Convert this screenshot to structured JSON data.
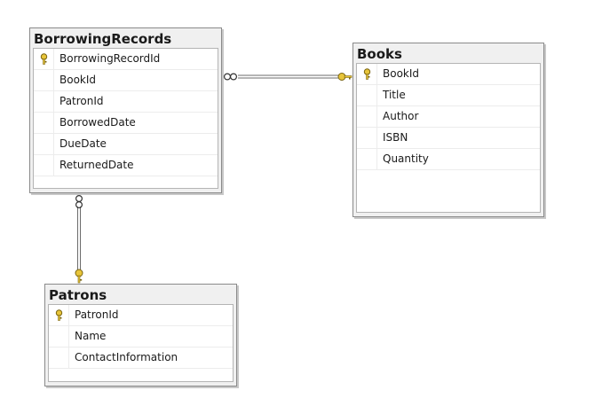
{
  "tables": {
    "borrowing": {
      "title": "BorrowingRecords",
      "columns": [
        {
          "name": "BorrowingRecordId",
          "pk": true
        },
        {
          "name": "BookId",
          "pk": false
        },
        {
          "name": "PatronId",
          "pk": false
        },
        {
          "name": "BorrowedDate",
          "pk": false
        },
        {
          "name": "DueDate",
          "pk": false
        },
        {
          "name": "ReturnedDate",
          "pk": false
        }
      ]
    },
    "books": {
      "title": "Books",
      "columns": [
        {
          "name": "BookId",
          "pk": true
        },
        {
          "name": "Title",
          "pk": false
        },
        {
          "name": "Author",
          "pk": false
        },
        {
          "name": "ISBN",
          "pk": false
        },
        {
          "name": "Quantity",
          "pk": false
        }
      ]
    },
    "patrons": {
      "title": "Patrons",
      "columns": [
        {
          "name": "PatronId",
          "pk": true
        },
        {
          "name": "Name",
          "pk": false
        },
        {
          "name": "ContactInformation",
          "pk": false
        }
      ]
    }
  },
  "relationships": [
    {
      "from": "BorrowingRecords",
      "to": "Books",
      "from_end": "many",
      "to_end": "one-key"
    },
    {
      "from": "BorrowingRecords",
      "to": "Patrons",
      "from_end": "many",
      "to_end": "one-key"
    }
  ],
  "colors": {
    "key": "#e8c53a",
    "key_outline": "#7a6410",
    "line": "#6b6b6b"
  }
}
